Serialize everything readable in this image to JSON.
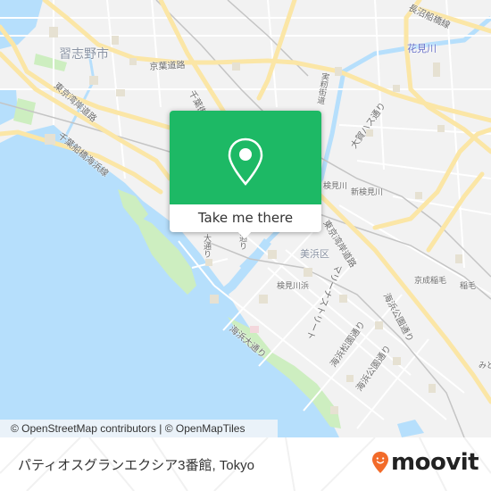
{
  "map": {
    "labels": {
      "city_narashino": "習志野市",
      "ward_mihama": "美浜区",
      "keiyo_road": "京葉道路",
      "higashi_kanto_road_w": "東京湾岸道路",
      "higashi_kanto_road_e": "東京湾岸道路",
      "chiba_funabashi_kaihin": "千葉船橋海浜線",
      "chiba_road": "千葉街道",
      "jitsuryo_road": "実籾街道",
      "naganuma_line": "長沼船橋線",
      "hanami_river": "花見川",
      "oga_hasu_dori": "大賀ハス通り",
      "kemigawa": "検見川",
      "shin_kemigawa": "新検見川",
      "kemigawahama": "検見川浜",
      "keisei_inage": "京成稲毛",
      "inage": "稲毛",
      "marinas_street": "マリーナストリート",
      "kaihin_matsu_dori": "海浜松園通り",
      "kaihin_koen_dori": "海浜公園通り",
      "kaihin_odori": "海浜大通り",
      "kaihin_koen_dori2": "海浜公園通り",
      "midori": "みど",
      "odori_left": "大通り",
      "dori_right": "通り"
    },
    "colors": {
      "water": "#b6dffc",
      "land": "#f2f2f2",
      "park": "#cdeec0",
      "major_road": "#fbe6a6",
      "minor_road": "#ffffff",
      "popup_green": "#1db965"
    }
  },
  "popup": {
    "icon": "location-pin-icon",
    "action_label": "Take me there"
  },
  "attribution": {
    "text": "© OpenStreetMap contributors | © OpenMapTiles"
  },
  "footer": {
    "place_name": "パティオスグランエクシア3番館, Tokyo",
    "brand": "moovit",
    "brand_color": "#f26b2a"
  }
}
